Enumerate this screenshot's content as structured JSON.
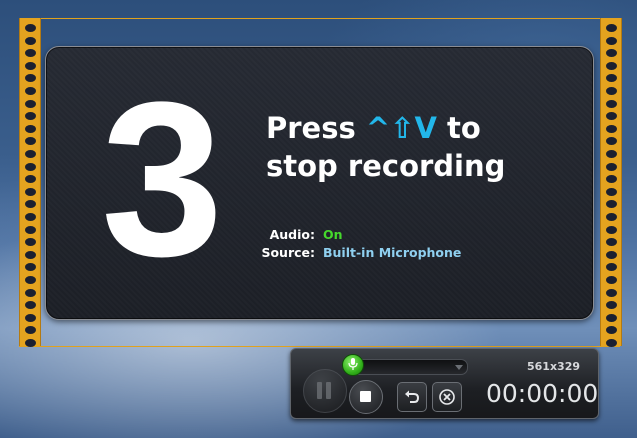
{
  "countdown": {
    "digit": "3",
    "press_word": "Press",
    "shortcut_keys": "^⇧V",
    "to_word": "to",
    "line2": "stop recording"
  },
  "audio": {
    "label": "Audio:",
    "value": "On"
  },
  "source": {
    "label": "Source:",
    "value": "Built-in Microphone"
  },
  "controls": {
    "capture_size": "561x329",
    "timer": "00:00:00",
    "icons": [
      "microphone-icon",
      "pause-icon",
      "stop-icon",
      "restart-icon",
      "cancel-icon"
    ]
  },
  "colors": {
    "frame": "#e4a31f",
    "shortcut": "#22b7ea",
    "audio_on": "#45d82c",
    "source_value": "#8fd0f0"
  }
}
